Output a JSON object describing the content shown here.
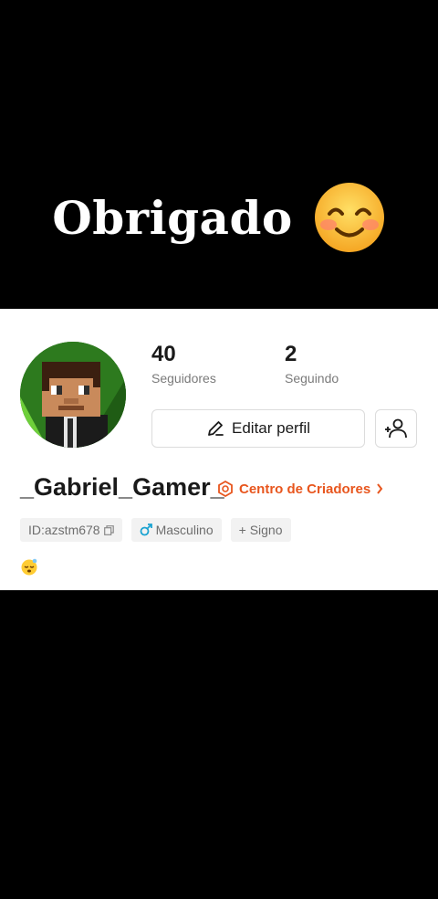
{
  "caption": {
    "text": "Obrigado",
    "emoji_icon": "smiling-face-icon"
  },
  "profile": {
    "followers": {
      "count": "40",
      "label": "Seguidores"
    },
    "following": {
      "count": "2",
      "label": "Seguindo"
    },
    "edit_button_label": "Editar perfil",
    "add_friend_icon": "add-user-icon",
    "username": "_Gabriel_Gamer_",
    "creator_center_label": "Centro de Criadores",
    "tags": {
      "id": "ID:azstm678",
      "gender": "Masculino",
      "sign": "+ Signo"
    },
    "bio_emoji_icon": "sleeping-face-icon"
  },
  "colors": {
    "accent": "#e8561e",
    "gender_icon": "#1aa3d1",
    "avatar_bg": "#2d7a1e"
  }
}
